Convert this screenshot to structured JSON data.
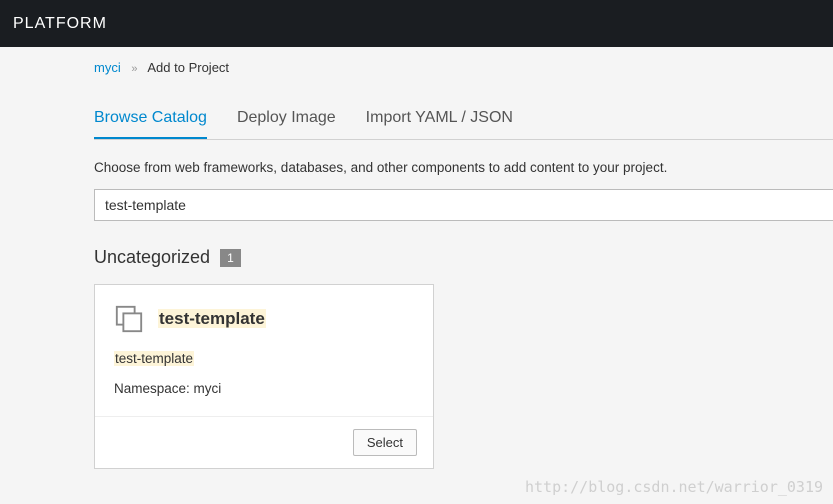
{
  "header": {
    "title": "PLATFORM"
  },
  "breadcrumb": {
    "link": "myci",
    "current": "Add to Project"
  },
  "tabs": {
    "browse": "Browse Catalog",
    "deploy": "Deploy Image",
    "import": "Import YAML / JSON"
  },
  "description": "Choose from web frameworks, databases, and other components to add content to your project.",
  "search": {
    "value": "test-template"
  },
  "category": {
    "title": "Uncategorized",
    "count": "1"
  },
  "card": {
    "title": "test-template",
    "subtitle": "test-template",
    "namespace_label": "Namespace: ",
    "namespace_value": "myci",
    "select_label": "Select"
  },
  "watermark": "http://blog.csdn.net/warrior_0319"
}
